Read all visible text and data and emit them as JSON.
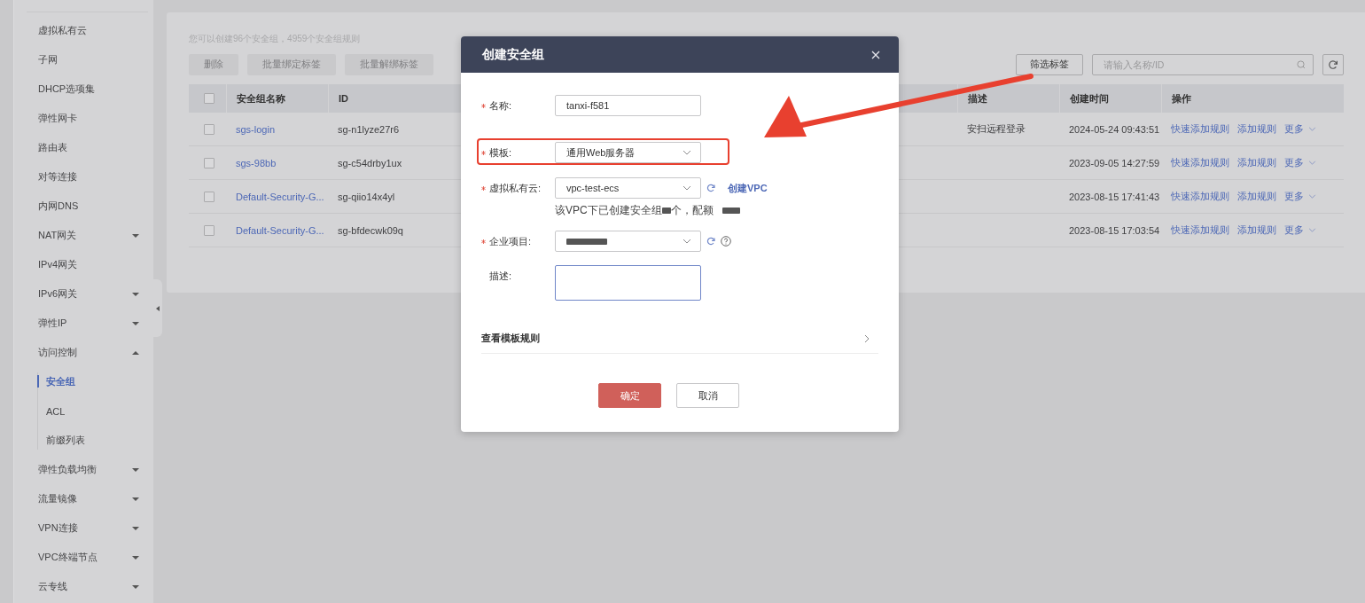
{
  "sidebar": {
    "items": [
      {
        "kind": "link",
        "label": "虚拟私有云",
        "selected": false
      },
      {
        "kind": "link",
        "label": "子网",
        "selected": false
      },
      {
        "kind": "link",
        "label": "DHCP选项集",
        "selected": false
      },
      {
        "kind": "link",
        "label": "弹性网卡",
        "selected": false
      },
      {
        "kind": "link",
        "label": "路由表",
        "selected": false
      },
      {
        "kind": "link",
        "label": "对等连接",
        "selected": false
      },
      {
        "kind": "link",
        "label": "内网DNS",
        "selected": false
      },
      {
        "kind": "group",
        "label": "NAT网关",
        "expanded": false
      },
      {
        "kind": "link",
        "label": "IPv4网关",
        "selected": false
      },
      {
        "kind": "group",
        "label": "IPv6网关",
        "expanded": false
      },
      {
        "kind": "group",
        "label": "弹性IP",
        "expanded": false
      },
      {
        "kind": "group",
        "label": "访问控制",
        "expanded": true,
        "children": [
          {
            "label": "安全组",
            "selected": true
          },
          {
            "label": "ACL",
            "selected": false
          },
          {
            "label": "前缀列表",
            "selected": false
          }
        ]
      },
      {
        "kind": "group",
        "label": "弹性负载均衡",
        "expanded": false
      },
      {
        "kind": "group",
        "label": "流量镜像",
        "expanded": false
      },
      {
        "kind": "group",
        "label": "VPN连接",
        "expanded": false
      },
      {
        "kind": "group",
        "label": "VPC终端节点",
        "expanded": false
      },
      {
        "kind": "group",
        "label": "云专线",
        "expanded": false
      }
    ]
  },
  "panel": {
    "notice": "您可以创建96个安全组，4959个安全组规则",
    "toolbar": [
      {
        "label": "删除",
        "disabled": true
      },
      {
        "label": "批量绑定标签",
        "disabled": true
      },
      {
        "label": "批量解绑标签",
        "disabled": true
      }
    ],
    "filter_button": "筛选标签",
    "search": {
      "placeholder": "请输入名称/ID"
    },
    "table": {
      "all_checked": false,
      "columns": [
        "安全组名称",
        "ID",
        "描述",
        "创建时间",
        "操作"
      ],
      "rows": [
        {
          "checked": false,
          "name": "sgs-login",
          "id": "sg-n1lyze27r6",
          "description": "安扫远程登录",
          "created": "2024-05-24 09:43:51",
          "actions": [
            "快速添加规则",
            "添加规则",
            "更多"
          ]
        },
        {
          "checked": false,
          "name": "sgs-98bb",
          "id": "sg-c54drby1ux",
          "description": "",
          "created": "2023-09-05 14:27:59",
          "actions": [
            "快速添加规则",
            "添加规则",
            "更多"
          ]
        },
        {
          "checked": false,
          "name": "Default-Security-G...",
          "id": "sg-qiio14x4yl",
          "description": "",
          "created": "2023-08-15 17:41:43",
          "actions": [
            "快速添加规则",
            "添加规则",
            "更多"
          ]
        },
        {
          "checked": false,
          "name": "Default-Security-G...",
          "id": "sg-bfdecwk09q",
          "description": "",
          "created": "2023-08-15 17:03:54",
          "actions": [
            "快速添加规则",
            "添加规则",
            "更多"
          ]
        }
      ]
    }
  },
  "dialog": {
    "title": "创建安全组",
    "fields": [
      {
        "kind": "input",
        "label": "名称:",
        "required": true,
        "value": "tanxi-f581",
        "highlighted": false
      },
      {
        "kind": "select",
        "label": "模板:",
        "required": true,
        "value": "通用Web服务器",
        "highlighted": true
      },
      {
        "kind": "select",
        "label": "虚拟私有云:",
        "required": true,
        "value": "vpc-test-ecs",
        "highlighted": false,
        "refresh": true,
        "link": "创建VPC",
        "hint": [
          "该VPC下已创建安全组",
          "个，配额"
        ]
      },
      {
        "kind": "select",
        "label": "企业项目:",
        "required": true,
        "redacted": true,
        "highlighted": false,
        "refresh": true,
        "help": true
      },
      {
        "kind": "textarea",
        "label": "描述:",
        "required": false,
        "focused": true,
        "highlighted": false
      }
    ],
    "rules_link": "查看模板规则",
    "buttons": [
      {
        "label": "确定",
        "primary": true
      },
      {
        "label": "取消",
        "primary": false
      }
    ]
  }
}
